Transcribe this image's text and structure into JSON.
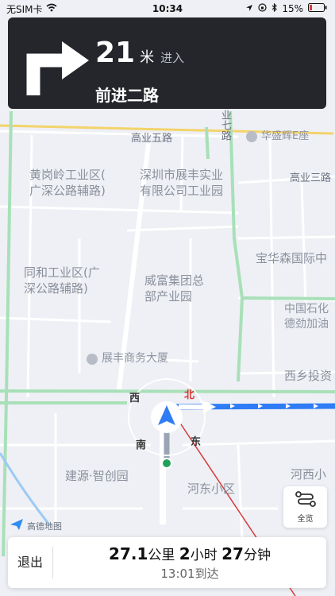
{
  "status_bar": {
    "carrier": "无SIM卡",
    "time": "10:34",
    "battery": "15%"
  },
  "maneuver": {
    "turn_icon": "turn-right-arrow-icon",
    "distance_value": "21",
    "distance_unit": "米",
    "action": "进入",
    "road_name": "前进二路"
  },
  "map": {
    "road_labels": [
      "高业五路",
      "高业三路",
      "业七路"
    ],
    "poi_labels": [
      "华盛辉E座",
      "黄岗岭工业区(\n广深公路辅路)",
      "深圳市展丰实业\n有限公司工业园",
      "宝华森国际中",
      "同和工业区(广\n深公路辅路)",
      "威富集团总\n部产业园",
      "中国石化\n德劲加油",
      "展丰商务大厦",
      "西乡投资",
      "建源·智创园",
      "河东小区",
      "河西小"
    ],
    "compass": {
      "north": "北",
      "west": "西",
      "south": "南",
      "east": "东"
    }
  },
  "overview_button": {
    "label": "全览",
    "icon": "route-overview-icon"
  },
  "logo": {
    "text": "高德地图"
  },
  "bottom_bar": {
    "exit_label": "退出",
    "distance_value": "27.1",
    "distance_unit": "公里",
    "hours_value": "2",
    "hours_unit": "小时",
    "minutes_value": "27",
    "minutes_unit": "分钟",
    "arrival": "13:01到达"
  },
  "colors": {
    "route": "#2f7cf6",
    "nav_card": "#24262b",
    "road_green": "#a8e0b8"
  }
}
